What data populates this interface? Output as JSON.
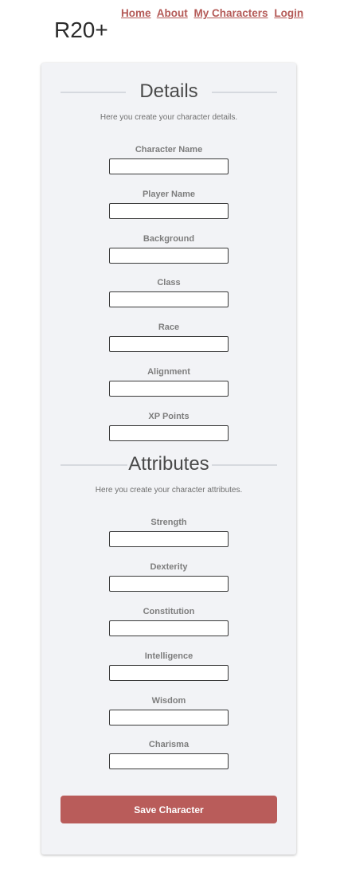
{
  "header": {
    "logo": "R20+",
    "nav": [
      "Home",
      "About",
      "My Characters",
      "Login"
    ]
  },
  "details": {
    "title": "Details",
    "subtitle": "Here you create your character details.",
    "fields": [
      "Character Name",
      "Player Name",
      "Background",
      "Class",
      "Race",
      "Alignment",
      "XP Points"
    ]
  },
  "attributes": {
    "title": "Attributes",
    "subtitle": "Here you create your character attributes.",
    "fields": [
      "Strength",
      "Dexterity",
      "Constitution",
      "Intelligence",
      "Wisdom",
      "Charisma"
    ]
  },
  "save_label": "Save Character",
  "colors": {
    "accent": "#b95c5a",
    "link": "#b45a57",
    "card_bg": "#f2f3f6"
  }
}
